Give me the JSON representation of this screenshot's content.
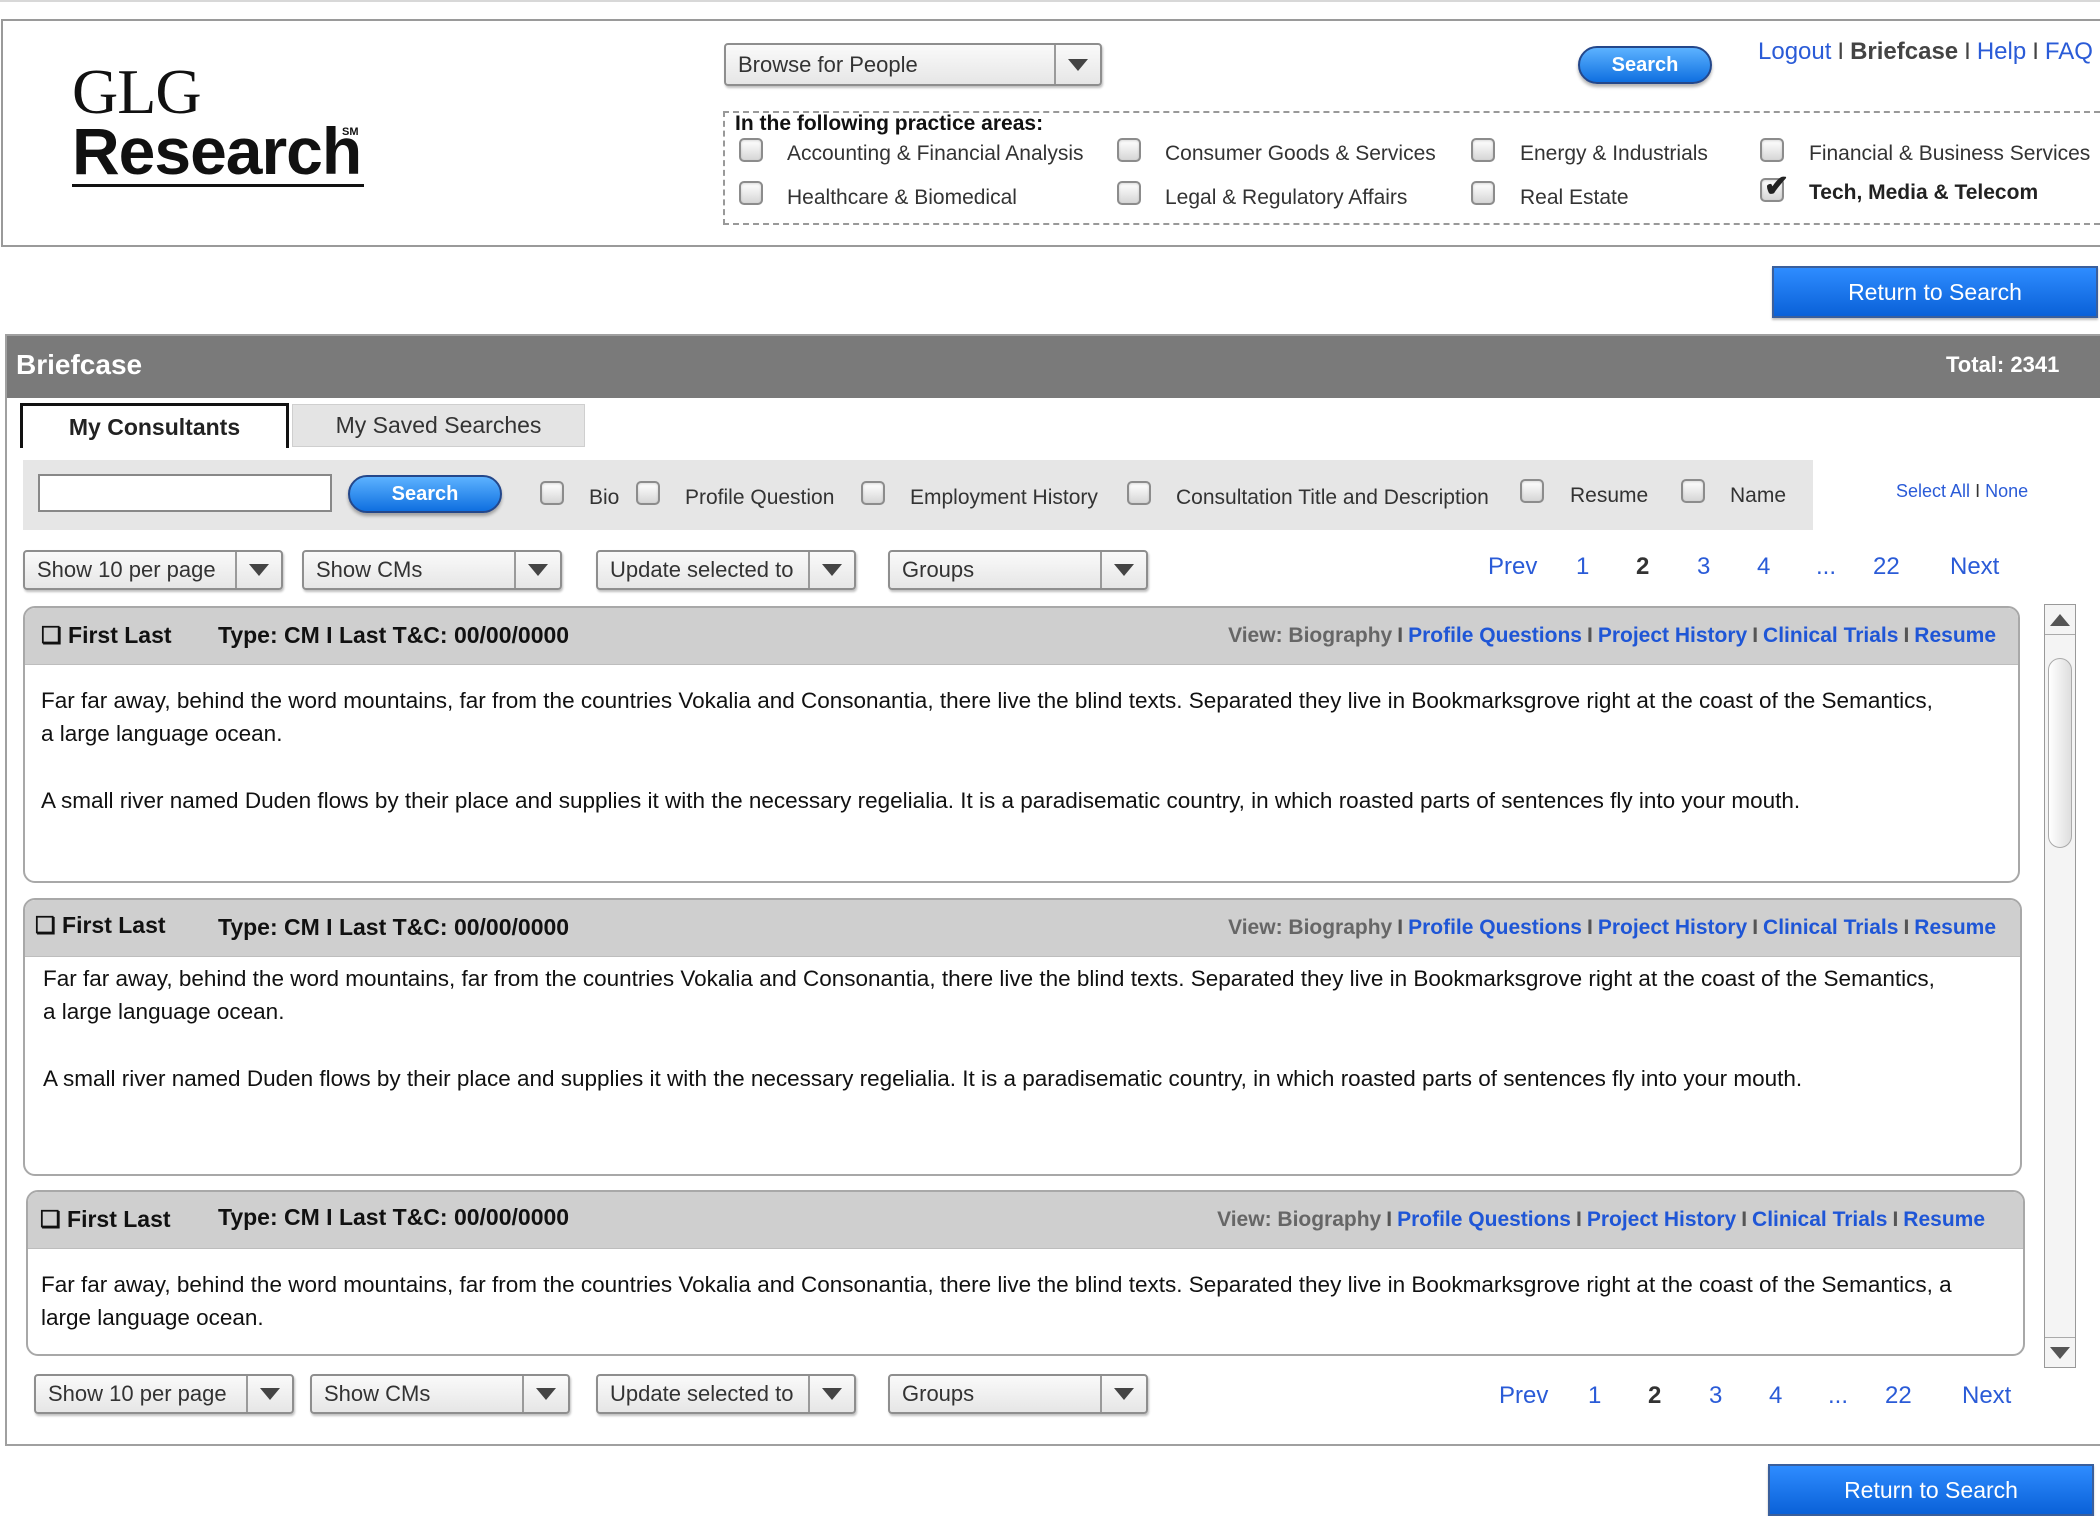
{
  "header": {
    "logo_top": "GLG",
    "logo_bottom": "Research",
    "logo_mark": "SM",
    "browse_select": "Browse for People",
    "search_button": "Search",
    "links": {
      "logout": "Logout",
      "briefcase": "Briefcase",
      "help": "Help",
      "faq": "FAQ",
      "separator": "I"
    },
    "practice_title": "In the following practice areas:",
    "practice_areas": [
      {
        "label": "Accounting & Financial Analysis",
        "checked": false
      },
      {
        "label": "Consumer Goods & Services",
        "checked": false
      },
      {
        "label": "Energy & Industrials",
        "checked": false
      },
      {
        "label": "Financial & Business Services",
        "checked": false
      },
      {
        "label": "Healthcare & Biomedical",
        "checked": false
      },
      {
        "label": "Legal & Regulatory Affairs",
        "checked": false
      },
      {
        "label": "Real Estate",
        "checked": false
      },
      {
        "label": "Tech, Media & Telecom",
        "checked": true
      }
    ]
  },
  "return_button": "Return to Search",
  "briefcase": {
    "title": "Briefcase",
    "total": "Total: 2341",
    "tabs": [
      "My Consultants",
      "My Saved Searches"
    ],
    "search_button": "Search",
    "search_value": "",
    "filters": [
      "Bio",
      "Profile Question",
      "Employment History",
      "Consultation Title and Description",
      "Resume",
      "Name"
    ],
    "select_all": "Select All",
    "select_sep": "I",
    "select_none": "None"
  },
  "controls": {
    "per_page": "Show 10 per page",
    "show": "Show CMs",
    "update": "Update selected to",
    "groups": "Groups"
  },
  "pagination": {
    "prev": "Prev",
    "pages": [
      "1",
      "2",
      "3",
      "4",
      "...",
      "22"
    ],
    "current": "2",
    "next": "Next"
  },
  "card_labels": {
    "checkbox_glyph": "❏",
    "view_label": "View: Biography",
    "sep": "I",
    "links": [
      "Profile Questions",
      "Project History",
      "Clinical Trials",
      "Resume"
    ]
  },
  "consultants": [
    {
      "name": "First Last",
      "meta": "Type: CM I Last T&C: 00/00/0000",
      "para1": "Far far away, behind the word mountains, far from the countries Vokalia and Consonantia, there live the blind texts. Separated they live in Bookmarksgrove right at the coast of the Semantics, a large language ocean.",
      "para2": "A small river named Duden flows by their place and supplies it with the necessary regelialia. It is a paradisematic country, in which roasted parts of sentences fly into your mouth."
    },
    {
      "name": "First Last",
      "meta": "Type: CM I Last T&C: 00/00/0000",
      "para1": "Far far away, behind the word mountains, far from the countries Vokalia and Consonantia, there live the blind texts. Separated they live in Bookmarksgrove right at the coast of the Semantics, a large language ocean.",
      "para2": "A small river named Duden flows by their place and supplies it with the necessary regelialia. It is a paradisematic country, in which roasted parts of sentences fly into your mouth."
    },
    {
      "name": "First Last",
      "meta": "Type: CM I Last T&C: 00/00/0000",
      "para1": "Far far away, behind the word mountains, far from the countries Vokalia and Consonantia, there live the blind texts. Separated they live in Bookmarksgrove right at the coast of the Semantics, a large language ocean."
    }
  ]
}
